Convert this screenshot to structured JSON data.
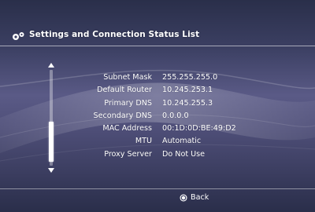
{
  "header": {
    "icon": "network-settings-icon",
    "title": "Settings and Connection Status List"
  },
  "status_list": {
    "rows": [
      {
        "label": "Subnet Mask",
        "value": "255.255.255.0"
      },
      {
        "label": "Default Router",
        "value": "10.245.253.1"
      },
      {
        "label": "Primary DNS",
        "value": "10.245.255.3"
      },
      {
        "label": "Secondary DNS",
        "value": "0.0.0.0"
      },
      {
        "label": "MAC Address",
        "value": "00:1D:0D:BE:49:D2"
      },
      {
        "label": "MTU",
        "value": "Automatic"
      },
      {
        "label": "Proxy Server",
        "value": "Do Not Use"
      }
    ]
  },
  "footer": {
    "back_icon": "circle-button-icon",
    "back_label": "Back"
  },
  "colors": {
    "text": "#ffffff",
    "background_top": "#2a2f4a",
    "background_mid": "#5a5a86",
    "background_bottom": "#2a2e4a"
  }
}
